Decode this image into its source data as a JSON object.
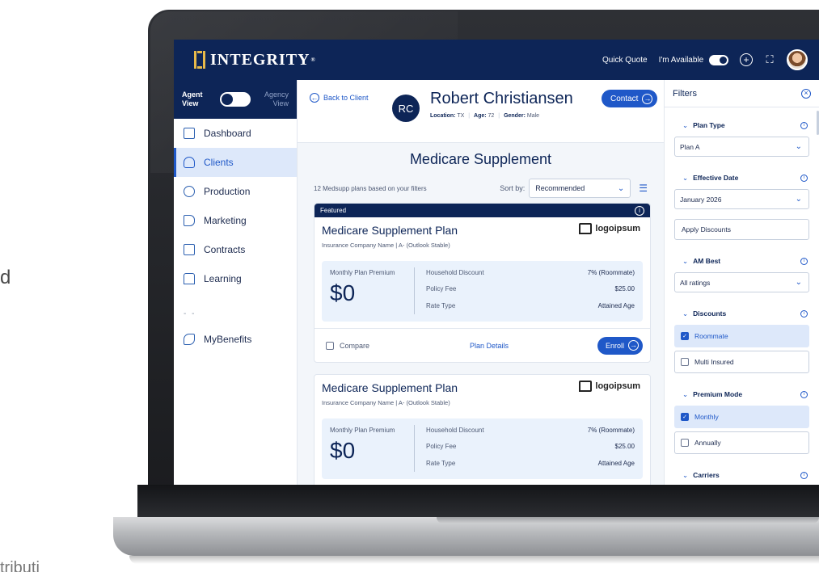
{
  "backdrop": {
    "left_letter": "d",
    "bottom_text": "tributi"
  },
  "topbar": {
    "brand": "INTEGRITY",
    "brand_reg": "®",
    "quick_quote": "Quick Quote",
    "availability_label": "I'm Available",
    "icons": [
      "plus-circle-icon",
      "scan-face-icon",
      "user-avatar"
    ]
  },
  "sidebar": {
    "agent_view": "Agent View",
    "agency_view": "Agency View",
    "items": [
      {
        "label": "Dashboard",
        "icon": "dashboard-icon",
        "active": false
      },
      {
        "label": "Clients",
        "icon": "clients-icon",
        "active": true
      },
      {
        "label": "Production",
        "icon": "production-icon",
        "active": false
      },
      {
        "label": "Marketing",
        "icon": "megaphone-icon",
        "active": false
      },
      {
        "label": "Contracts",
        "icon": "contracts-icon",
        "active": false
      },
      {
        "label": "Learning",
        "icon": "book-icon",
        "active": false
      }
    ],
    "separator": "- -",
    "benefits": {
      "label": "MyBenefits",
      "icon": "tag-icon"
    }
  },
  "client": {
    "back_label": "Back to Client",
    "initials": "RC",
    "name": "Robert Christiansen",
    "location_label": "Location:",
    "location": "TX",
    "age_label": "Age:",
    "age": "72",
    "gender_label": "Gender:",
    "gender": "Male",
    "contact_label": "Contact"
  },
  "results": {
    "title": "Medicare Supplement",
    "count_text": "12 Medsupp plans based on your filters",
    "sort_label": "Sort by:",
    "sort_value": "Recommended"
  },
  "plans": [
    {
      "featured_label": "Featured",
      "name": "Medicare Supplement Plan",
      "subtitle": "Insurance Company Name  |  A- (Outlook Stable)",
      "carrier_logo": "logoipsum",
      "premium_label": "Monthly Plan Premium",
      "premium": "$0",
      "rows": [
        {
          "label": "Household Discount",
          "value": "7% (Roommate)"
        },
        {
          "label": "Policy Fee",
          "value": "$25.00"
        },
        {
          "label": "Rate Type",
          "value": "Attained Age"
        }
      ],
      "compare_label": "Compare",
      "details_label": "Plan Details",
      "enroll_label": "Enroll"
    },
    {
      "name": "Medicare Supplement Plan",
      "subtitle": "Insurance Company Name  |  A- (Outlook Stable)",
      "carrier_logo": "logoipsum",
      "premium_label": "Monthly Plan Premium",
      "premium": "$0",
      "rows": [
        {
          "label": "Household Discount",
          "value": "7% (Roommate)"
        },
        {
          "label": "Policy Fee",
          "value": "$25.00"
        },
        {
          "label": "Rate Type",
          "value": "Attained Age"
        }
      ]
    }
  ],
  "filters": {
    "title": "Filters",
    "plan_type": {
      "label": "Plan Type",
      "value": "Plan A"
    },
    "effective_date": {
      "label": "Effective Date",
      "value": "January 2026"
    },
    "apply_discounts": "Apply Discounts",
    "am_best": {
      "label": "AM Best",
      "value": "All ratings"
    },
    "discounts": {
      "label": "Discounts",
      "options": [
        {
          "label": "Roommate",
          "checked": true
        },
        {
          "label": "Multi Insured",
          "checked": false
        }
      ]
    },
    "premium_mode": {
      "label": "Premium Mode",
      "options": [
        {
          "label": "Monthly",
          "checked": true
        },
        {
          "label": "Annually",
          "checked": false
        }
      ]
    },
    "carriers": {
      "label": "Carriers"
    }
  },
  "colors": {
    "navy": "#0d2557",
    "accent_blue": "#1f58c8",
    "gold": "#e7b94a",
    "light_blue": "#dde8fa"
  }
}
